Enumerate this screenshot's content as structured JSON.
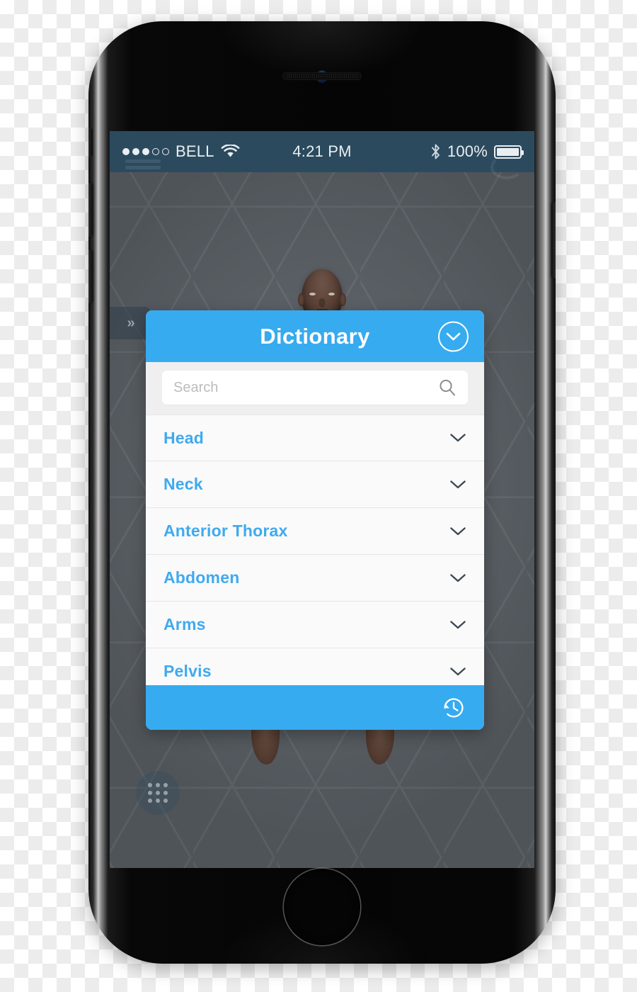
{
  "colors": {
    "accent_blue": "#36ABF0",
    "list_label_blue": "#3FAAEF",
    "status_bar": "#2B4A5E",
    "panel_bg": "#FAFAFA",
    "search_strip": "#EFEFEF",
    "app_background": "#5E646A"
  },
  "status_bar": {
    "signal_dots_filled": 3,
    "signal_dots_total": 5,
    "carrier": "BELL",
    "wifi_icon": "wifi-icon",
    "time": "4:21 PM",
    "bluetooth_icon": "bluetooth-icon",
    "battery_percent": "100%",
    "battery_level": 100
  },
  "app": {
    "drawer_handle_label": "»",
    "grid_menu_icon": "grid-dots-icon"
  },
  "dictionary": {
    "title": "Dictionary",
    "collapse_icon": "chevron-down-circle-icon",
    "search": {
      "placeholder": "Search",
      "value": "",
      "icon": "search-icon"
    },
    "items": [
      {
        "label": "Head",
        "icon": "chevron-down-icon"
      },
      {
        "label": "Neck",
        "icon": "chevron-down-icon"
      },
      {
        "label": "Anterior Thorax",
        "icon": "chevron-down-icon"
      },
      {
        "label": "Abdomen",
        "icon": "chevron-down-icon"
      },
      {
        "label": "Arms",
        "icon": "chevron-down-icon"
      },
      {
        "label": "Pelvis",
        "icon": "chevron-down-icon"
      }
    ],
    "footer": {
      "history_icon": "history-clock-icon"
    }
  }
}
